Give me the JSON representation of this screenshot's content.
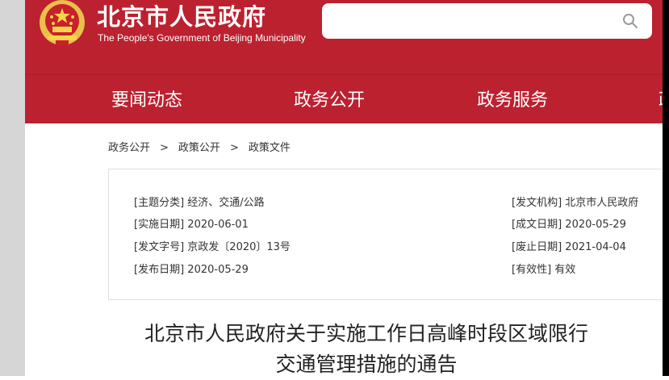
{
  "header": {
    "title": "北京市人民政府",
    "subtitle": "The People's Government of Beijing Municipality",
    "emblem_icon": "national-emblem-icon",
    "search": {
      "placeholder": "",
      "icon": "search-icon"
    },
    "brand_color": "#bc2130"
  },
  "nav": {
    "items": [
      {
        "label": "要闻动态"
      },
      {
        "label": "政务公开"
      },
      {
        "label": "政务服务"
      },
      {
        "label": "政"
      }
    ]
  },
  "breadcrumb": {
    "items": [
      "政务公开",
      "政策公开",
      "政策文件"
    ],
    "separator": ">"
  },
  "info": {
    "left": [
      {
        "label": "[主题分类]",
        "value": "经济、交通/公路"
      },
      {
        "label": "[实施日期]",
        "value": "2020-06-01"
      },
      {
        "label": "[发文字号]",
        "value": "京政发〔2020〕13号"
      },
      {
        "label": "[发布日期]",
        "value": "2020-05-29"
      }
    ],
    "right": [
      {
        "label": "[发文机构]",
        "value": "北京市人民政府"
      },
      {
        "label": "[成文日期]",
        "value": "2020-05-29"
      },
      {
        "label": "[废止日期]",
        "value": "2021-04-04"
      },
      {
        "label": "[有效性]",
        "value": "有效"
      }
    ]
  },
  "document": {
    "title_line1": "北京市人民政府关于实施工作日高峰时段区域限行",
    "title_line2": "交通管理措施的通告"
  }
}
